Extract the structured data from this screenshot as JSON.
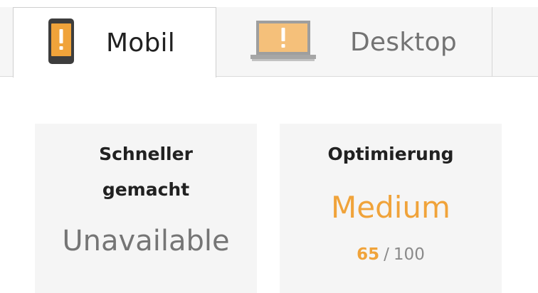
{
  "tabs": {
    "mobile": {
      "label": "Mobil",
      "icon": "phone-warning-icon",
      "selected": true
    },
    "desktop": {
      "label": "Desktop",
      "icon": "laptop-warning-icon",
      "selected": false
    }
  },
  "cards": {
    "speed": {
      "title_line1": "Schneller",
      "title_line2": "gemacht",
      "value": "Unavailable"
    },
    "optimization": {
      "title": "Optimierung",
      "rating": "Medium",
      "score": "65",
      "separator": "/",
      "max": "100"
    }
  },
  "colors": {
    "warning_orange": "#f0a33a",
    "device_body": "#3d3d3d",
    "laptop_gray": "#9e9e9e",
    "card_background": "#f5f5f5"
  }
}
